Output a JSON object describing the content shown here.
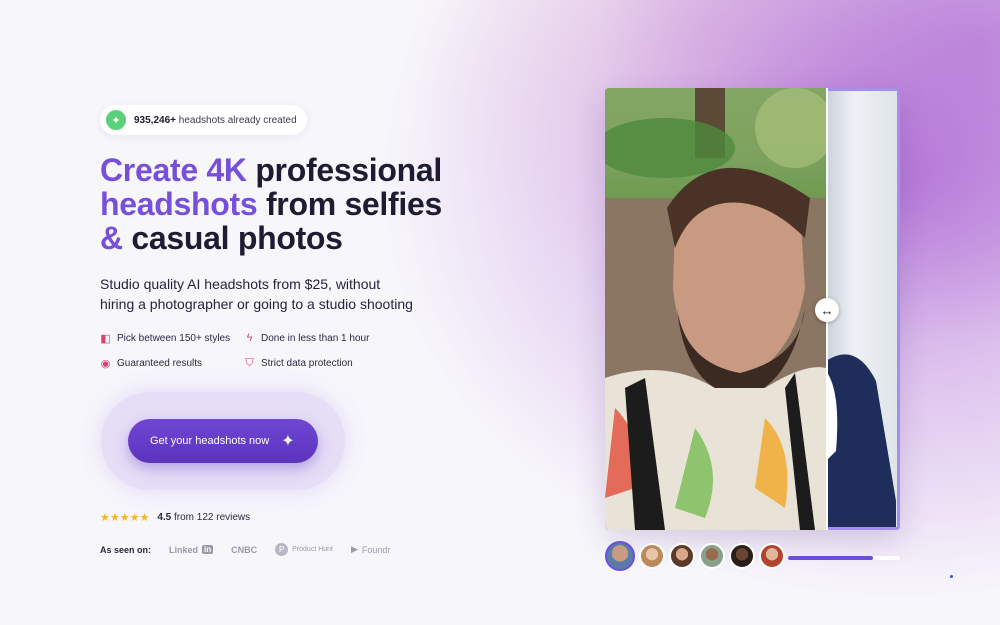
{
  "badge": {
    "count": "935,246+",
    "text": "headshots already created",
    "icon": "sparkle-icon"
  },
  "headline": {
    "line1_accent": "Create 4K",
    "line1_rest": "professional",
    "line2_accent": "headshots",
    "line2_rest": "from selfies",
    "line3": "& casual photos"
  },
  "subtitle": {
    "line1": "Studio quality AI headshots from $25, without",
    "line2": "hiring a photographer or going to a studio shooting"
  },
  "features": [
    {
      "label": "Pick between 150+ styles",
      "icon": "styles-icon"
    },
    {
      "label": "Done in less than 1 hour",
      "icon": "lightning-icon"
    },
    {
      "label": "Guaranteed results",
      "icon": "award-icon"
    },
    {
      "label": "Strict data protection",
      "icon": "shield-icon"
    }
  ],
  "cta": {
    "label": "Get your headshots now",
    "icon": "sparkle-icon"
  },
  "rating": {
    "stars": "★★★★★",
    "score": "4.5",
    "text": "from 122 reviews"
  },
  "seen_on": {
    "label": "As seen on:",
    "logos": [
      "Linked",
      "in",
      "CNBC",
      "P",
      "Product Hunt",
      "Foundr"
    ]
  },
  "comparison": {
    "handle_icon": "↔",
    "avatars_count": 6,
    "active_avatar": 0,
    "progress": 0.76
  },
  "colors": {
    "accent": "#7650d8",
    "cta": "#5b33bd",
    "star": "#f6b51e",
    "feature_icon": "#e0406f"
  }
}
